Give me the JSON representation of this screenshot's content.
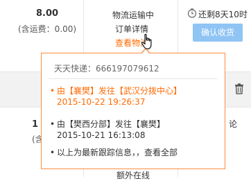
{
  "order": {
    "price": "8.00",
    "shipping_note": "(含运费：0.00)",
    "status": "物流运输中",
    "detail_link": "订单详情",
    "logistics_link": "查看物流",
    "countdown": "还剩8天10时",
    "confirm_button": "确认收货"
  },
  "background_partial": {
    "price_fragment": "1",
    "shipping_fragment": "(含运",
    "right_fragment": "论",
    "bottom_fragment": "额外在线"
  },
  "logistics_popup": {
    "header": "天天快递：666197079612",
    "events": [
      {
        "text": "由【襄樊】发往【武汉分拨中心】",
        "time": "2015-10-22 19:26:37"
      },
      {
        "text": "由【樊西分部】发往【襄樊】",
        "time": "2015-10-21 16:13:08"
      }
    ],
    "footer": "以上为最新跟踪信息，，查看全部"
  },
  "colors": {
    "accent_orange": "#ff6a00",
    "button_blue": "#8fc4f4",
    "popup_border": "#ff8a3d"
  },
  "icons": [
    "clock-icon",
    "trash-icon",
    "hand-pointer-icon"
  ]
}
